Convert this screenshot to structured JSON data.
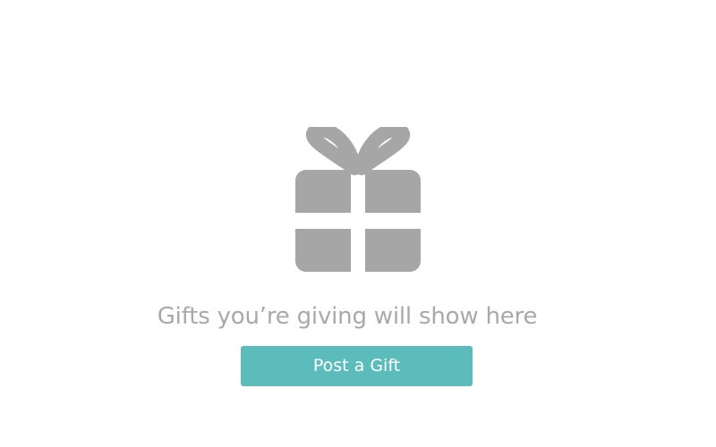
{
  "empty_state": {
    "icon": "gift-icon",
    "icon_color": "#a6a6a6",
    "message": "Gifts you’re giving will show here",
    "message_color": "#a9a9a9"
  },
  "actions": {
    "post_gift_label": "Post a Gift",
    "post_gift_color": "#5bbcbb"
  }
}
